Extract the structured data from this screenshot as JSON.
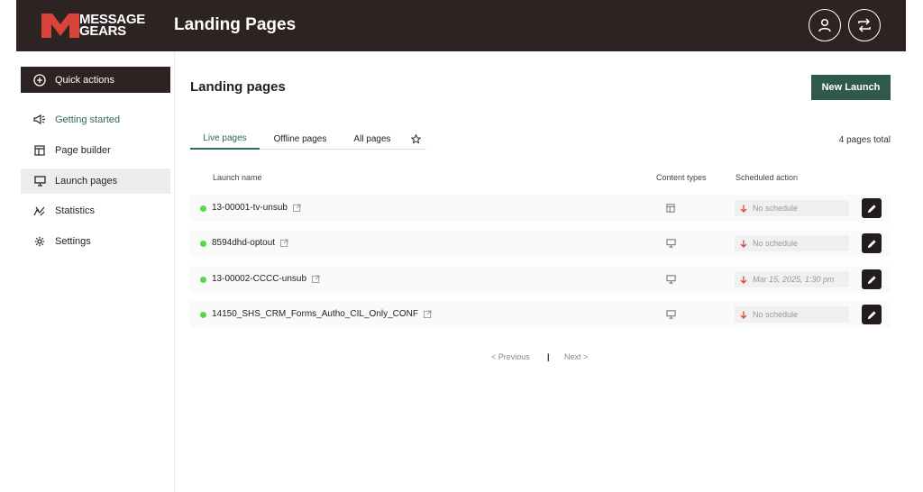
{
  "header": {
    "logo_line1": "MESSAGE",
    "logo_line2": "GEARS",
    "app_title": "Landing Pages",
    "profile_icon": "user-icon",
    "switch_icon": "swap-arrows-icon"
  },
  "sidebar": {
    "quick_actions": "Quick actions",
    "items": [
      {
        "label": "Getting started",
        "icon": "megaphone-icon"
      },
      {
        "label": "Page builder",
        "icon": "layout-icon"
      },
      {
        "label": "Launch pages",
        "icon": "monitor-icon"
      },
      {
        "label": "Statistics",
        "icon": "chart-icon"
      },
      {
        "label": "Settings",
        "icon": "gear-icon"
      }
    ]
  },
  "main": {
    "heading": "Landing pages",
    "new_launch": "New Launch",
    "tabs": [
      "Live pages",
      "Offline pages",
      "All pages"
    ],
    "total": "4 pages total",
    "columns": {
      "name": "Launch name",
      "content_types": "Content types",
      "scheduled": "Scheduled action"
    },
    "rows": [
      {
        "name": "13-00001-tv-unsub",
        "content_icon": "layout-icon",
        "schedule": "No schedule"
      },
      {
        "name": "8594dhd-optout",
        "content_icon": "monitor-icon",
        "schedule": "No schedule"
      },
      {
        "name": "13-00002-CCCC-unsub",
        "content_icon": "monitor-icon",
        "schedule": "Mar 15, 2025, 1:30 pm"
      },
      {
        "name": "14150_SHS_CRM_Forms_Autho_CIL_Only_CONF",
        "content_icon": "monitor-icon",
        "schedule": "No schedule"
      }
    ],
    "pager": {
      "prev": "< Previous",
      "sep": "|",
      "next": "Next >"
    }
  },
  "colors": {
    "header_bg": "#2d2322",
    "accent_green": "#2f5a4a",
    "status_live": "#57d84a",
    "arrow_red": "#d9443a"
  }
}
